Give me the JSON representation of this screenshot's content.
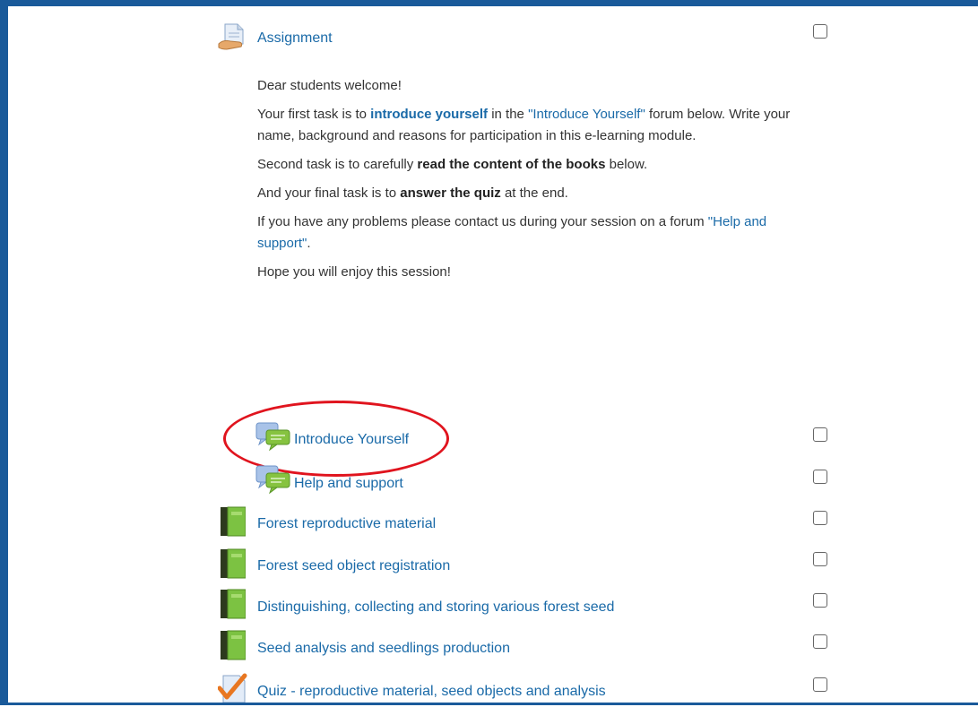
{
  "assignment": {
    "title": "Assignment",
    "greeting": "Dear students welcome!",
    "task1_a": "Your first task is to ",
    "task1_bold": "introduce yourself",
    "task1_b": " in the ",
    "task1_link": "\"Introduce Yourself\"",
    "task1_c": " forum below. Write your name, background and reasons for participation in this e-learning module.",
    "task2_a": "Second task is to carefully ",
    "task2_bold": "read the content of the books",
    "task2_b": " below.",
    "task3_a": "And your final task is to ",
    "task3_bold": "answer the quiz",
    "task3_b": " at the end.",
    "support_a": "If you have any problems please contact us during your session on a forum ",
    "support_link": "\"Help and support\"",
    "support_b": ".",
    "closing": "Hope you will enjoy this session!"
  },
  "activities": [
    {
      "label": "Introduce Yourself",
      "icon": "forum-icon"
    },
    {
      "label": "Help and support",
      "icon": "forum-icon"
    },
    {
      "label": "Forest reproductive material",
      "icon": "book-icon"
    },
    {
      "label": "Forest seed object registration",
      "icon": "book-icon"
    },
    {
      "label": "Distinguishing, collecting and storing various forest seed",
      "icon": "book-icon"
    },
    {
      "label": "Seed analysis and seedlings production",
      "icon": "book-icon"
    },
    {
      "label": "Quiz - reproductive material, seed objects and analysis",
      "icon": "quiz-icon"
    }
  ],
  "colors": {
    "link": "#1a6aa8",
    "border": "#1a5a9a",
    "highlight": "#e0141e",
    "book": "#7cc242"
  }
}
